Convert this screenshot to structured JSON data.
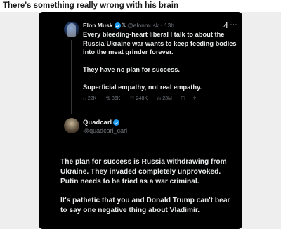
{
  "caption": "There's something really wrong with his brain",
  "tweet1": {
    "name": "Elon Musk",
    "handle": "@elonmusk",
    "time": "13h",
    "x_badge": "𝕏",
    "paragraphs": [
      "Every bleeding-heart liberal I talk to about the Russia-Ukraine war wants to keep feeding bodies into the meat grinder forever.",
      "They have no plan for success.",
      "Superficial empathy, not real empathy."
    ],
    "actions": {
      "replies": "22K",
      "reposts": "36K",
      "likes": "248K",
      "views": "23M"
    },
    "icons": {
      "grok": "grok-icon",
      "more": "more-icon",
      "reply": "reply-icon",
      "repost": "repost-icon",
      "like": "heart-icon",
      "views": "views-icon",
      "bookmark": "bookmark-icon",
      "share": "share-icon"
    }
  },
  "tweet2": {
    "name": "Quadcarl",
    "handle": "@quadcarl_carl",
    "paragraphs": [
      "The plan for success is Russia withdrawing from Ukraine. They invaded completely unprovoked. Putin needs to be tried as a war criminal.",
      "It's pathetic that you and Donald Trump can't bear to say one negative thing about Vladimir."
    ]
  },
  "colors": {
    "background": "#000000",
    "text": "#e7e9ea",
    "muted": "#71767b",
    "verified": "#1d9bf0"
  }
}
